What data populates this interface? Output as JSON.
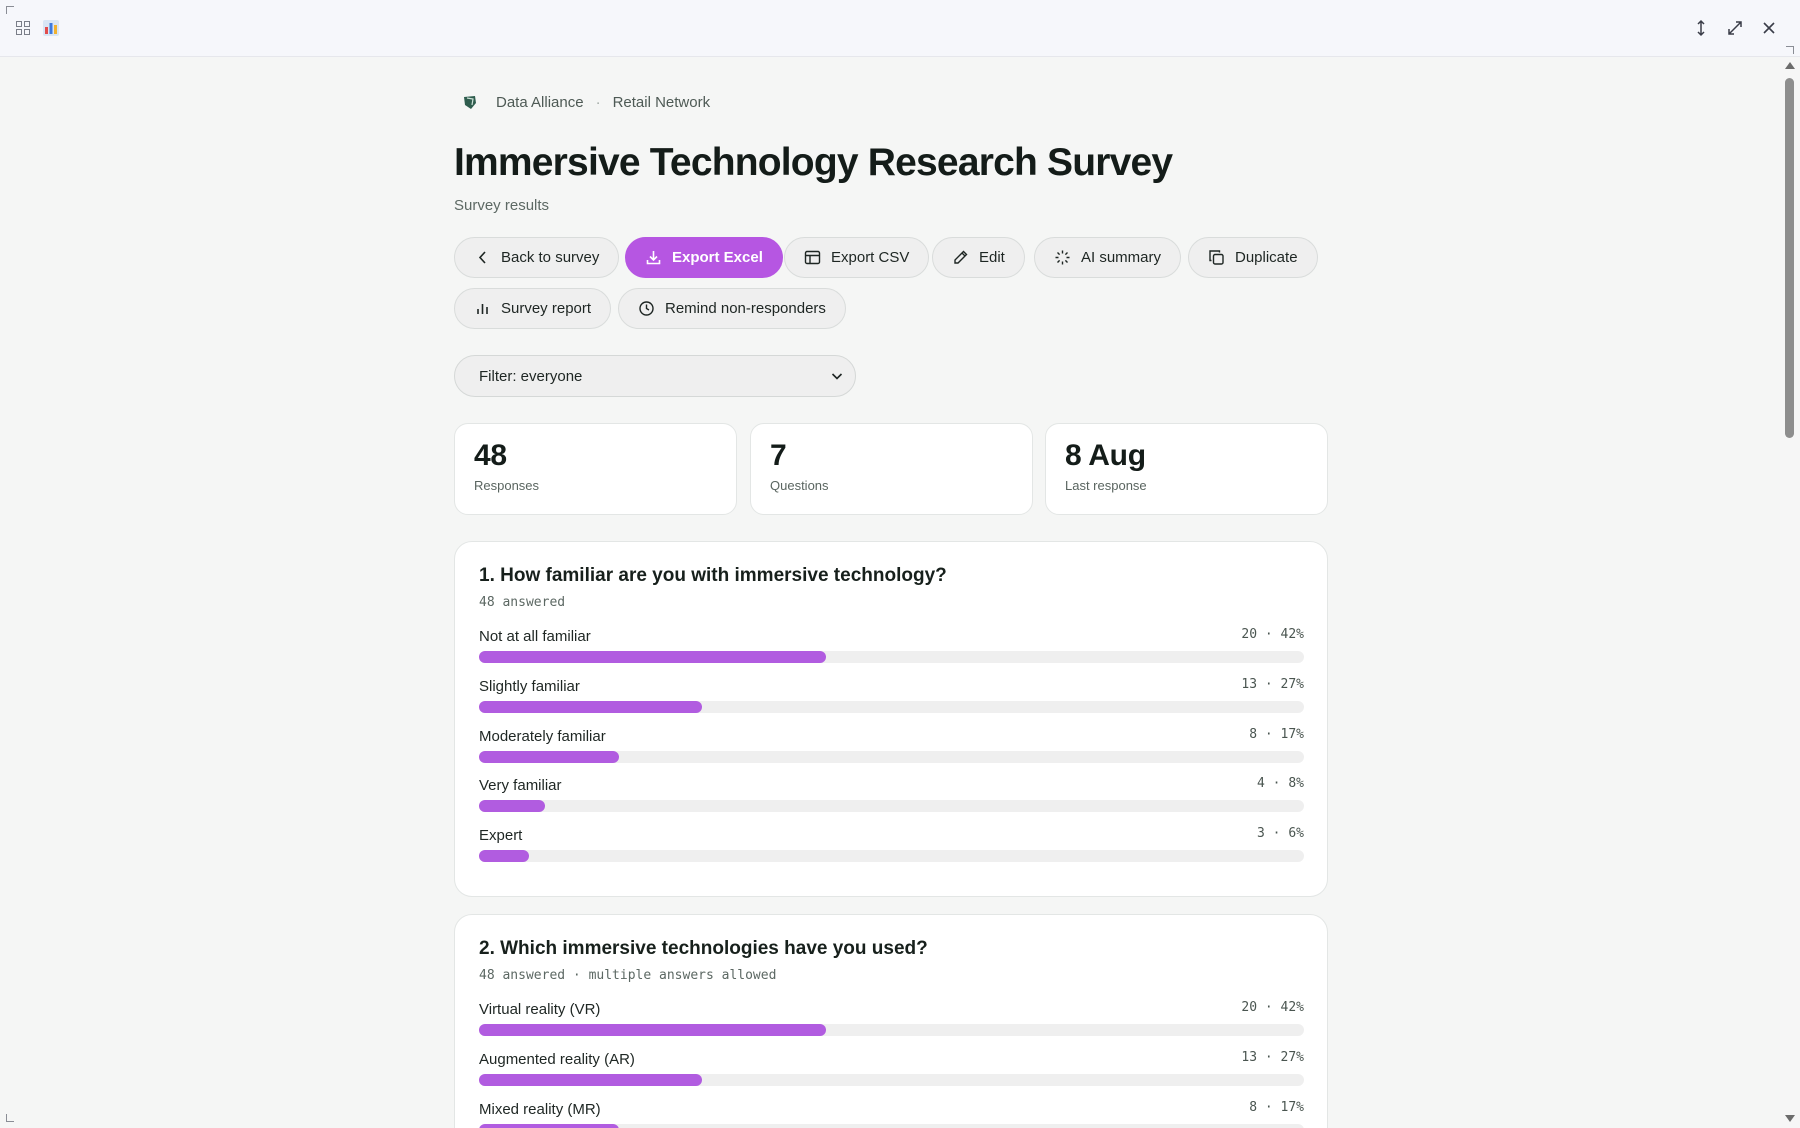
{
  "window": {
    "icons": [
      "grid-icon",
      "app-icon",
      "resize-vertical-icon",
      "maximize-icon",
      "close-icon"
    ]
  },
  "breadcrumb": {
    "org": "Data Alliance",
    "separator": "·",
    "network": "Retail Network"
  },
  "page": {
    "title": "Immersive Technology Research Survey",
    "subtitle": "Survey results"
  },
  "actions": {
    "back": "Back to survey",
    "export_excel": "Export Excel",
    "export_csv": "Export CSV",
    "edit": "Edit",
    "ai_summary": "AI summary",
    "duplicate": "Duplicate",
    "survey_report": "Survey report",
    "remind": "Remind non-responders"
  },
  "filter": {
    "value": "Filter: everyone"
  },
  "stats": [
    {
      "value": "48",
      "label": "Responses"
    },
    {
      "value": "7",
      "label": "Questions"
    },
    {
      "value": "8 Aug",
      "label": "Last response"
    }
  ],
  "questions": [
    {
      "title": "1. How familiar are you with immersive technology?",
      "meta": "48 answered",
      "options": [
        {
          "label": "Not at all familiar",
          "count": "20 · 42%",
          "pct": 42
        },
        {
          "label": "Slightly familiar",
          "count": "13 · 27%",
          "pct": 27
        },
        {
          "label": "Moderately familiar",
          "count": "8 · 17%",
          "pct": 17
        },
        {
          "label": "Very familiar",
          "count": "4 · 8%",
          "pct": 8
        },
        {
          "label": "Expert",
          "count": "3 · 6%",
          "pct": 6
        }
      ]
    },
    {
      "title": "2. Which immersive technologies have you used?",
      "meta": "48 answered · multiple answers allowed",
      "options": [
        {
          "label": "Virtual reality (VR)",
          "count": "20 · 42%",
          "pct": 42
        },
        {
          "label": "Augmented reality (AR)",
          "count": "13 · 27%",
          "pct": 27
        },
        {
          "label": "Mixed reality (MR)",
          "count": "8 · 17%",
          "pct": 17
        }
      ]
    }
  ],
  "colors": {
    "accent": "#b656e2",
    "bar": "#b15ce0",
    "track": "#efefef"
  }
}
